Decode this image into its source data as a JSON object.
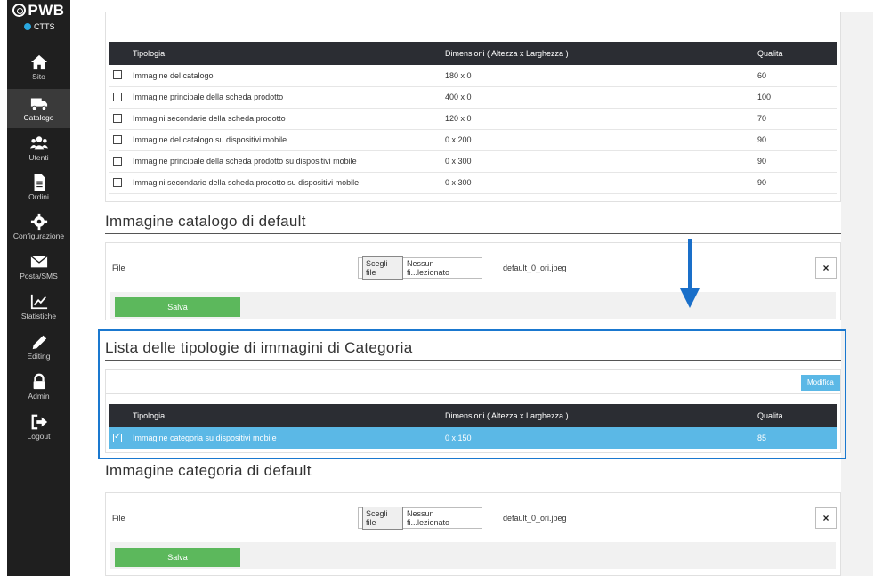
{
  "sidebar": {
    "brand": "PWB",
    "env_label": "CTTS",
    "items": [
      {
        "label": "Sito",
        "icon": "home-icon"
      },
      {
        "label": "Catalogo",
        "icon": "truck-icon",
        "active": true
      },
      {
        "label": "Utenti",
        "icon": "users-icon"
      },
      {
        "label": "Ordini",
        "icon": "document-icon"
      },
      {
        "label": "Configurazione",
        "icon": "gear-icon"
      },
      {
        "label": "Posta/SMS",
        "icon": "envelope-icon"
      },
      {
        "label": "Statistiche",
        "icon": "chart-icon"
      },
      {
        "label": "Editing",
        "icon": "pencil-icon"
      },
      {
        "label": "Admin",
        "icon": "lock-icon"
      },
      {
        "label": "Logout",
        "icon": "logout-icon"
      }
    ]
  },
  "product_table": {
    "headers": [
      "Tipologia",
      "Dimensioni ( Altezza x Larghezza )",
      "Qualita"
    ],
    "rows": [
      {
        "tipologia": "Immagine del catalogo",
        "dimensioni": "180 x 0",
        "qualita": "60"
      },
      {
        "tipologia": "Immagine principale della scheda prodotto",
        "dimensioni": "400 x 0",
        "qualita": "100"
      },
      {
        "tipologia": "Immagini secondarie della scheda prodotto",
        "dimensioni": "120 x 0",
        "qualita": "70"
      },
      {
        "tipologia": "Immagine del catalogo su dispositivi mobile",
        "dimensioni": "0 x 200",
        "qualita": "90"
      },
      {
        "tipologia": "Immagine principale della scheda prodotto su dispositivi mobile",
        "dimensioni": "0 x 300",
        "qualita": "90"
      },
      {
        "tipologia": "Immagini secondarie della scheda prodotto su dispositivi mobile",
        "dimensioni": "0 x 300",
        "qualita": "90"
      }
    ]
  },
  "catalog_default": {
    "title": "Immagine catalogo di default",
    "file_label": "File",
    "choose_button": "Scegli file",
    "no_file_text": "Nessun fi...lezionato",
    "current_file": "default_0_ori.jpeg",
    "close": "×",
    "save": "Salva"
  },
  "category_list": {
    "title": "Lista delle tipologie di immagini di Categoria",
    "modify_button": "Modifica",
    "headers": [
      "Tipologia",
      "Dimensioni ( Altezza x Larghezza )",
      "Qualita"
    ],
    "rows": [
      {
        "tipologia": "Immagine categoria su dispositivi mobile",
        "dimensioni": "0 x 150",
        "qualita": "85",
        "checked": true
      }
    ]
  },
  "category_default": {
    "title": "Immagine categoria di default",
    "file_label": "File",
    "choose_button": "Scegli file",
    "no_file_text": "Nessun fi...lezionato",
    "current_file": "default_0_ori.jpeg",
    "close": "×",
    "save": "Salva"
  },
  "colors": {
    "sidebar_bg": "#1f1f1f",
    "table_header_bg": "#2b2d33",
    "selected_row": "#5bb8e6",
    "save_green": "#5cb85c",
    "highlight_border": "#1a78cf",
    "annotation_arrow": "#1a6fc9"
  }
}
